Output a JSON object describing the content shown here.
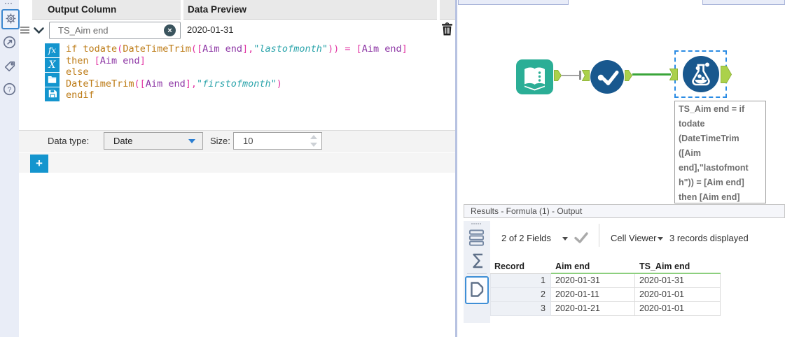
{
  "left_rail": {
    "icons": [
      "gear",
      "navigate",
      "tag",
      "help"
    ]
  },
  "config": {
    "header": {
      "output_column": "Output Column",
      "data_preview": "Data Preview"
    },
    "field": {
      "name": "TS_Aim end",
      "preview": "2020-01-31"
    },
    "editor_buttons": {
      "functions": "fx",
      "variables": "X"
    },
    "formula_lines": [
      [
        {
          "t": "if ",
          "c": "kw"
        },
        {
          "t": "todate",
          "c": "kw"
        },
        {
          "t": "(",
          "c": "pu"
        },
        {
          "t": "DateTimeTrim",
          "c": "kw"
        },
        {
          "t": "([",
          "c": "pu"
        },
        {
          "t": "Aim end",
          "c": "col"
        },
        {
          "t": "],",
          "c": "pu"
        },
        {
          "t": "\"lastofmonth\"",
          "c": "str"
        },
        {
          "t": ")) = [",
          "c": "pu"
        },
        {
          "t": "Aim end",
          "c": "col"
        },
        {
          "t": "]",
          "c": "pu"
        }
      ],
      [
        {
          "t": "then ",
          "c": "kw"
        },
        {
          "t": "[",
          "c": "pu"
        },
        {
          "t": "Aim end",
          "c": "col"
        },
        {
          "t": "]",
          "c": "pu"
        }
      ],
      [
        {
          "t": "else",
          "c": "kw"
        }
      ],
      [
        {
          "t": "DateTimeTrim",
          "c": "kw"
        },
        {
          "t": "([",
          "c": "pu"
        },
        {
          "t": "Aim end",
          "c": "col"
        },
        {
          "t": "],",
          "c": "pu"
        },
        {
          "t": "\"firstofmonth\"",
          "c": "str"
        },
        {
          "t": ")",
          "c": "pu"
        }
      ],
      [
        {
          "t": "endif",
          "c": "kw"
        }
      ]
    ],
    "data_type": {
      "label": "Data type:",
      "value": "Date"
    },
    "size": {
      "label": "Size:",
      "value": "10"
    },
    "add_button_label": "+"
  },
  "canvas": {
    "tools": [
      "input-data-tool",
      "check-tool",
      "formula-tool"
    ],
    "selected_tool": "formula-tool",
    "tooltip_lines": [
      "TS_Aim end = if",
      "todate",
      "(DateTimeTrim",
      "([Aim",
      "end],\"lastofmont",
      "h\")) = [Aim end]",
      "then [Aim end]"
    ]
  },
  "results": {
    "title": "Results - Formula (1) - Output",
    "toolbar": {
      "fields_summary": "2 of 2 Fields",
      "cell_viewer": "Cell Viewer",
      "records_summary": "3 records displayed"
    },
    "table": {
      "columns": [
        "Record",
        "Aim end",
        "TS_Aim end"
      ],
      "rows": [
        [
          "1",
          "2020-01-31",
          "2020-01-31"
        ],
        [
          "2",
          "2020-01-11",
          "2020-01-01"
        ],
        [
          "3",
          "2020-01-21",
          "2020-01-01"
        ]
      ]
    }
  },
  "colors": {
    "accent_blue": "#1495ce",
    "tool_blue": "#19588e",
    "tool_teal": "#2bae96",
    "anchor_green": "#abd14b",
    "wire_green": "#3aa53a",
    "wire_gray": "#a3a3a3",
    "selection_blue": "#2b8ce4",
    "keyword": "#bd7b16",
    "punctuation": "#e236a4",
    "column_ref": "#8d36a5",
    "string": "#2ba4ab",
    "results_header_green": "#8ccf7e"
  }
}
